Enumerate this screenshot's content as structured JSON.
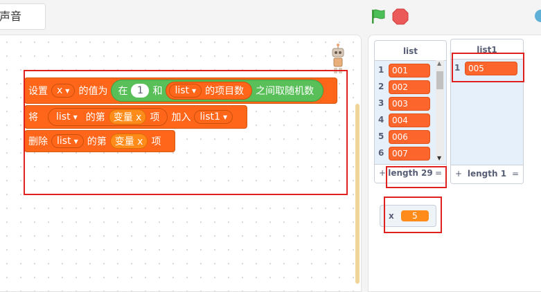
{
  "header": {
    "sound_tab": "声音",
    "green_flag_icon": "green-flag-icon",
    "stop_icon": "stop-icon"
  },
  "blocks": {
    "set_block": {
      "prefix": "设置",
      "variable": "x",
      "middle": "的值为",
      "random": {
        "prefix": "在",
        "from": "1",
        "and": "和",
        "list_name": "list",
        "list_suffix": "的项目数",
        "suffix": "之间取随机数"
      }
    },
    "add_block": {
      "prefix": "将",
      "list": "list",
      "item_label": "的第",
      "variable": "变量 x",
      "item_suffix": "项",
      "add_to": "加入",
      "target_list": "list1"
    },
    "delete_block": {
      "prefix": "删除",
      "list": "list",
      "item_label": "的第",
      "variable": "变量 x",
      "item_suffix": "项"
    }
  },
  "monitors": {
    "list": {
      "title": "list",
      "items": [
        {
          "index": "1",
          "value": "001"
        },
        {
          "index": "2",
          "value": "002"
        },
        {
          "index": "3",
          "value": "003"
        },
        {
          "index": "4",
          "value": "004"
        },
        {
          "index": "5",
          "value": "006"
        },
        {
          "index": "6",
          "value": "007"
        }
      ],
      "plus": "+",
      "length": "length 29",
      "equals": "="
    },
    "list1": {
      "title": "list1",
      "items": [
        {
          "index": "1",
          "value": "005"
        }
      ],
      "plus": "+",
      "length": "length 1",
      "equals": "="
    },
    "variable_x": {
      "name": "x",
      "value": "5"
    }
  },
  "colors": {
    "block_orange": "#ff661a",
    "operator_green": "#59c059",
    "variable_orange": "#ff8c1a",
    "highlight_red": "#e0201f",
    "list_cell": "#fc662c"
  }
}
